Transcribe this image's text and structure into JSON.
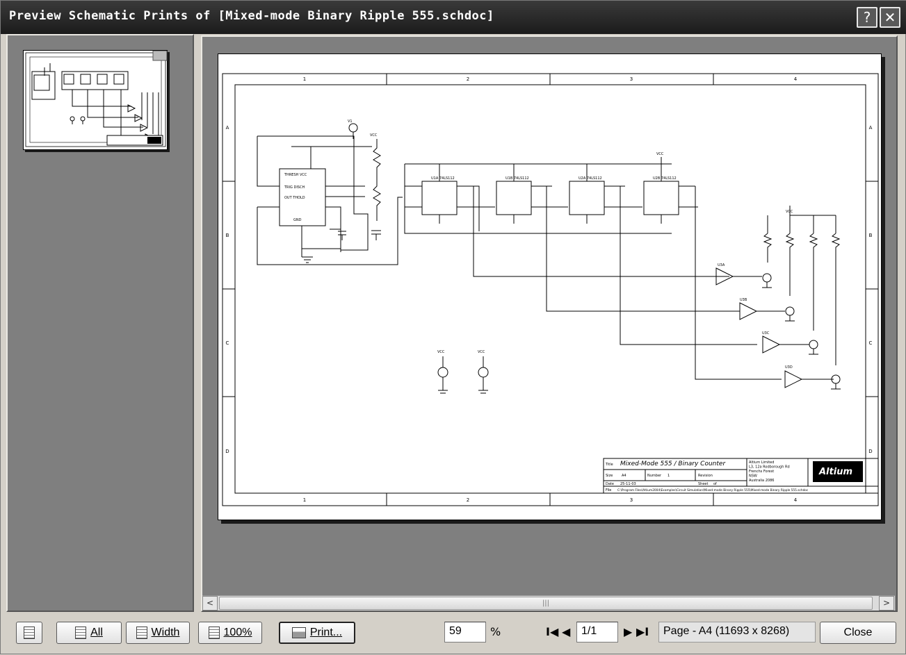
{
  "window": {
    "title": "Preview Schematic Prints of [Mixed-mode Binary Ripple 555.schdoc]",
    "help_glyph": "?",
    "close_glyph": "✕"
  },
  "sheet": {
    "title_label": "Title",
    "title": "Mixed-Mode 555 / Binary Counter",
    "company_lines": [
      "Altium Limited",
      "L3, 12a Rodborough Rd",
      "Frenchs Forest",
      "NSW",
      "Australia 2086"
    ],
    "logo": "Altium",
    "size_label": "Size",
    "size": "A4",
    "number_label": "Number",
    "number": "1",
    "revision_label": "Revision",
    "date_label": "Date",
    "date": "25-11-03",
    "sheet_label": "Sheet",
    "sheet": "of",
    "file_label": "File",
    "file": "C:\\Program Files\\Altium2004\\Examples\\Circuit Simulation\\Mixed-mode Binary Ripple 555\\Mixed-mode Binary Ripple 555.schdoc",
    "border_cols": [
      "1",
      "2",
      "3",
      "4"
    ],
    "border_rows": [
      "A",
      "B",
      "C",
      "D"
    ]
  },
  "toolbar": {
    "all_label": "All",
    "width_label": "Width",
    "zoom100_label": "100%",
    "print_label": "Print...",
    "zoom_value": "59",
    "zoom_unit": "%",
    "first_glyph": "I◀",
    "prev_glyph": "◀",
    "page_value": "1/1",
    "next_glyph": "▶",
    "last_glyph": "▶I",
    "page_info": "Page - A4 (11693 x 8268)",
    "close_label": "Close"
  },
  "scrollbar": {
    "left_glyph": "<",
    "right_glyph": ">",
    "grip": "|||"
  }
}
